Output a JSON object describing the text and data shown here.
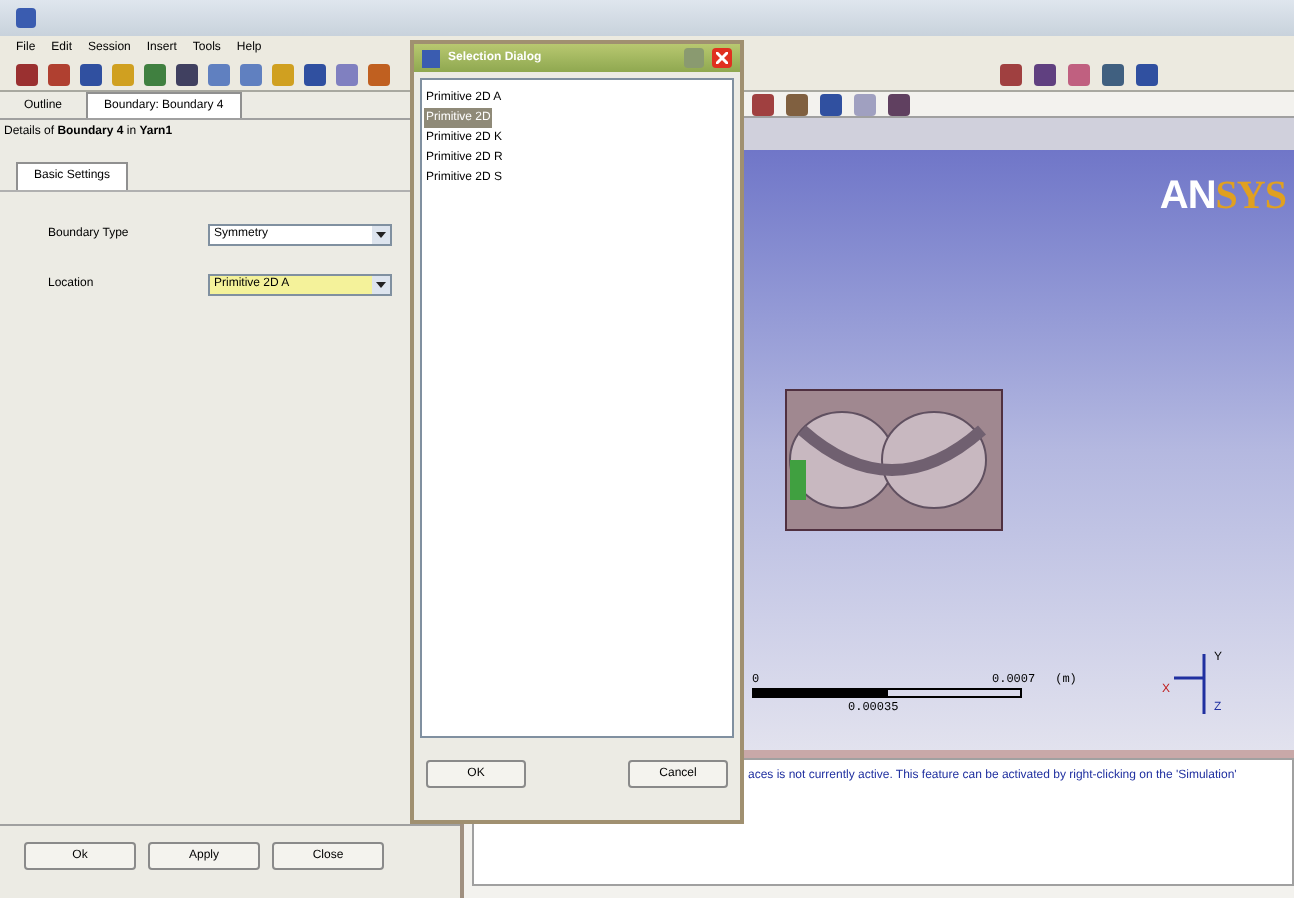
{
  "menu": [
    "File",
    "Edit",
    "Session",
    "Insert",
    "Tools",
    "Help"
  ],
  "panel_tabs": [
    {
      "label": "Outline",
      "selected": false
    },
    {
      "label": "Boundary: Boundary 4",
      "selected": true
    }
  ],
  "details_title": "Details of **Boundary 4** in **Yarn1**",
  "settings_tabs": [
    {
      "label": "Basic Settings",
      "selected": true
    }
  ],
  "fields": [
    {
      "label": "Boundary Type",
      "value": "Symmetry",
      "highlighted": false
    },
    {
      "label": "Location",
      "value": "Primitive 2D A",
      "highlighted": true
    }
  ],
  "panel_buttons": [
    "Ok",
    "Apply",
    "Close"
  ],
  "viewport": {
    "logo_left": "AN",
    "logo_right": "SYS",
    "scale": {
      "start": "0",
      "end": "0.0007",
      "unit": "(m)",
      "mid": "0.00035"
    },
    "axes": {
      "y": "Y",
      "x": "X",
      "z": "Z"
    }
  },
  "message": "aces is not currently active. This feature can be activated by right-clicking on the 'Simulation'",
  "dialog": {
    "title": "Selection Dialog",
    "items": [
      {
        "label": "Primitive 2D A",
        "selected": false
      },
      {
        "label": "Primitive 2D",
        "selected": true
      },
      {
        "label": "Primitive 2D K",
        "selected": false
      },
      {
        "label": "Primitive 2D R",
        "selected": false
      },
      {
        "label": "Primitive 2D S",
        "selected": false
      }
    ],
    "buttons": [
      "OK",
      "Cancel"
    ]
  }
}
